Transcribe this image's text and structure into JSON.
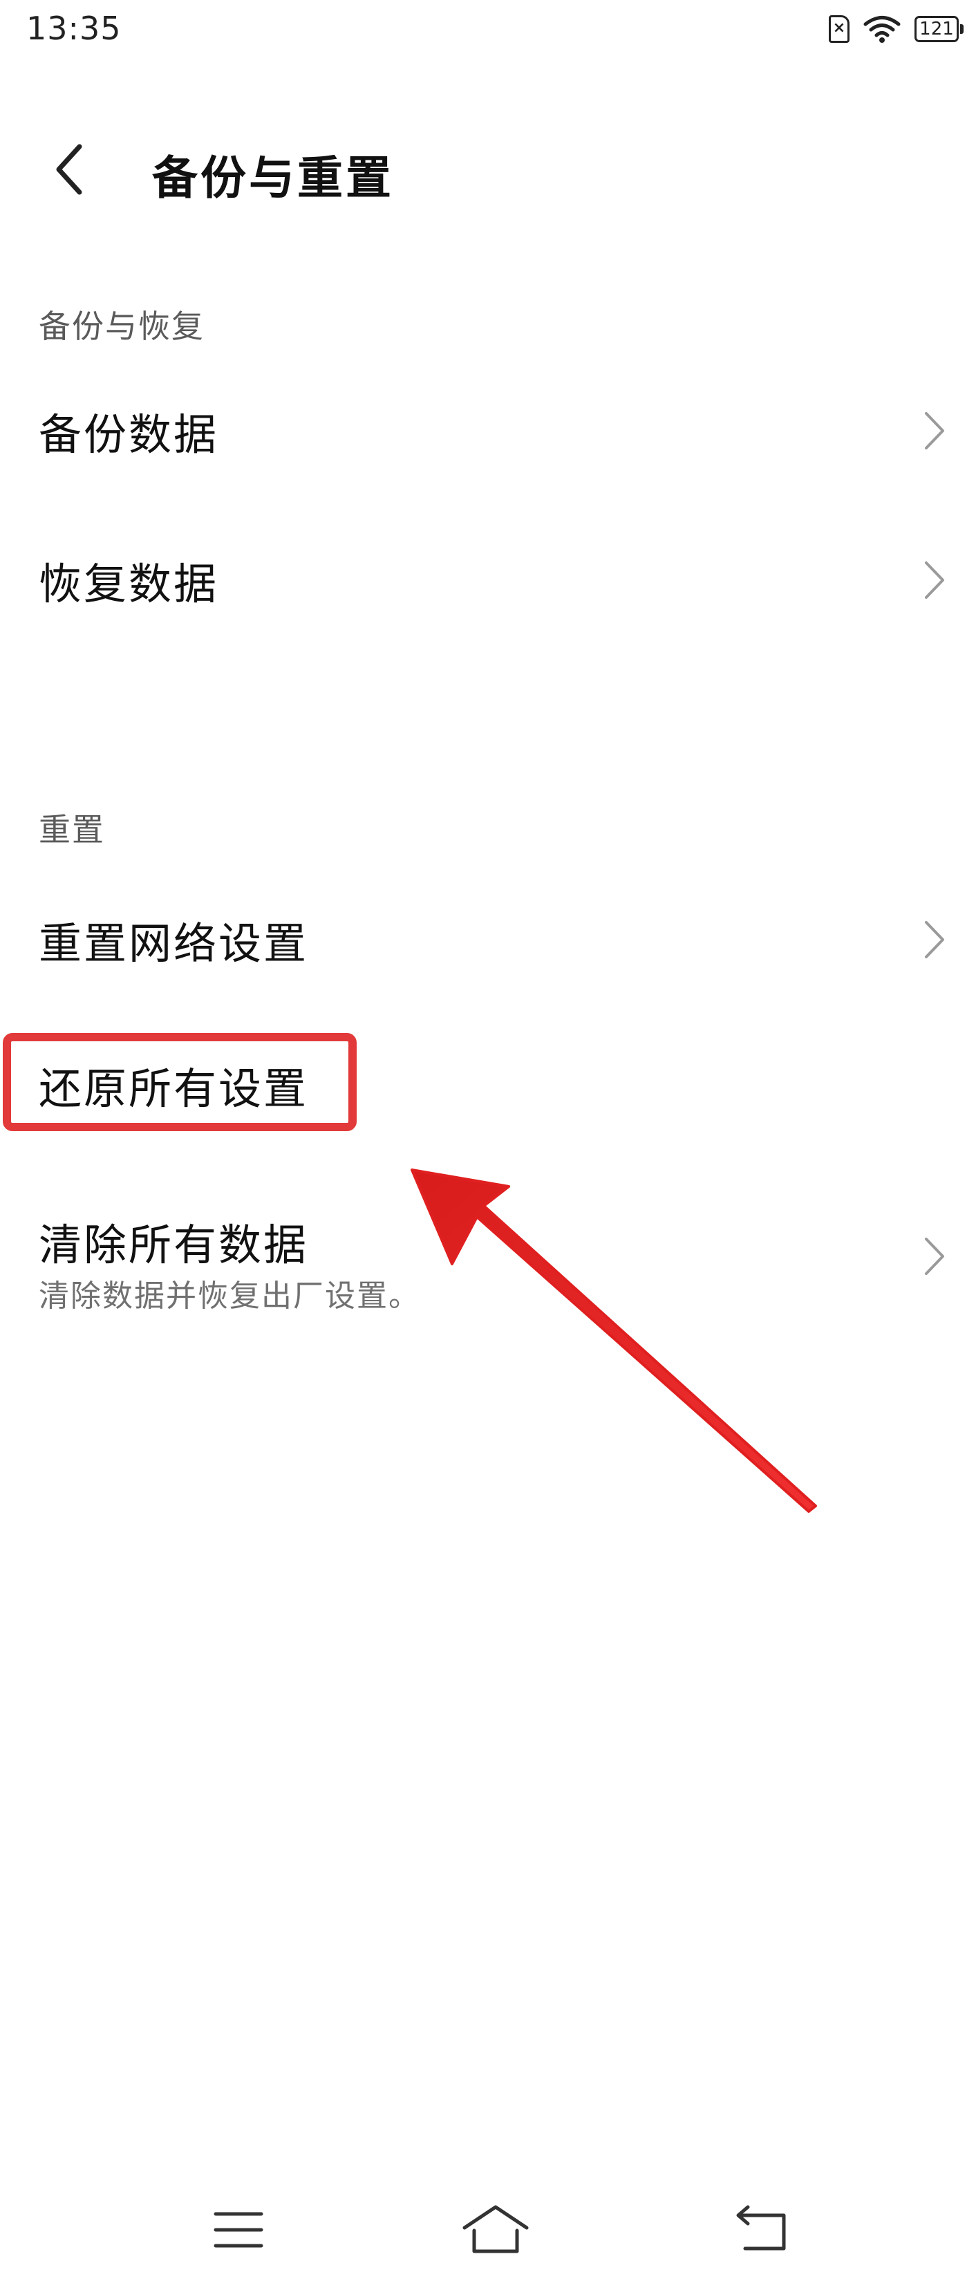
{
  "status_bar": {
    "time": "13:35",
    "battery": "121",
    "sim_mark": "×"
  },
  "header": {
    "title": "备份与重置"
  },
  "sections": {
    "backup": {
      "label": "备份与恢复",
      "items": [
        {
          "label": "备份数据"
        },
        {
          "label": "恢复数据"
        }
      ]
    },
    "reset": {
      "label": "重置",
      "items": [
        {
          "label": "重置网络设置"
        },
        {
          "label": "还原所有设置"
        },
        {
          "label": "清除所有数据",
          "subtitle": "清除数据并恢复出厂设置。"
        }
      ]
    }
  },
  "annotations": {
    "highlight_color": "#e23a3a",
    "arrow_color": "#e02020"
  },
  "icons": {
    "back": "back-arrow-icon",
    "chevron": "chevron-right-icon",
    "menu": "menu-icon",
    "home": "home-icon",
    "return": "return-icon",
    "wifi": "wifi-icon",
    "battery": "battery-icon",
    "sim": "sim-card-icon"
  }
}
